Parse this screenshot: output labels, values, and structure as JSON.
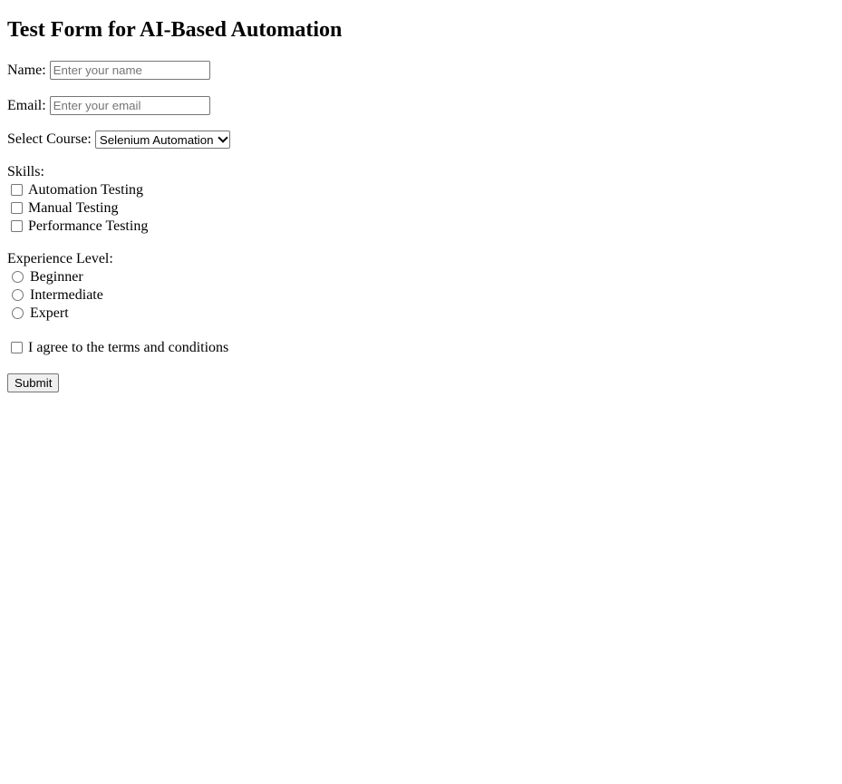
{
  "form": {
    "title": "Test Form for AI-Based Automation",
    "name_label": "Name:",
    "name_placeholder": "Enter your name",
    "email_label": "Email:",
    "email_placeholder": "Enter your email",
    "course_label": "Select Course:",
    "course_selected": "Selenium Automation",
    "skills_label": "Skills:",
    "skills": [
      {
        "label": "Automation Testing",
        "checked": false
      },
      {
        "label": "Manual Testing",
        "checked": false
      },
      {
        "label": "Performance Testing",
        "checked": false
      }
    ],
    "experience_label": "Experience Level:",
    "experience": [
      {
        "label": "Beginner",
        "selected": false
      },
      {
        "label": "Intermediate",
        "selected": false
      },
      {
        "label": "Expert",
        "selected": false
      }
    ],
    "terms_label": "I agree to the terms and conditions",
    "submit_label": "Submit"
  }
}
